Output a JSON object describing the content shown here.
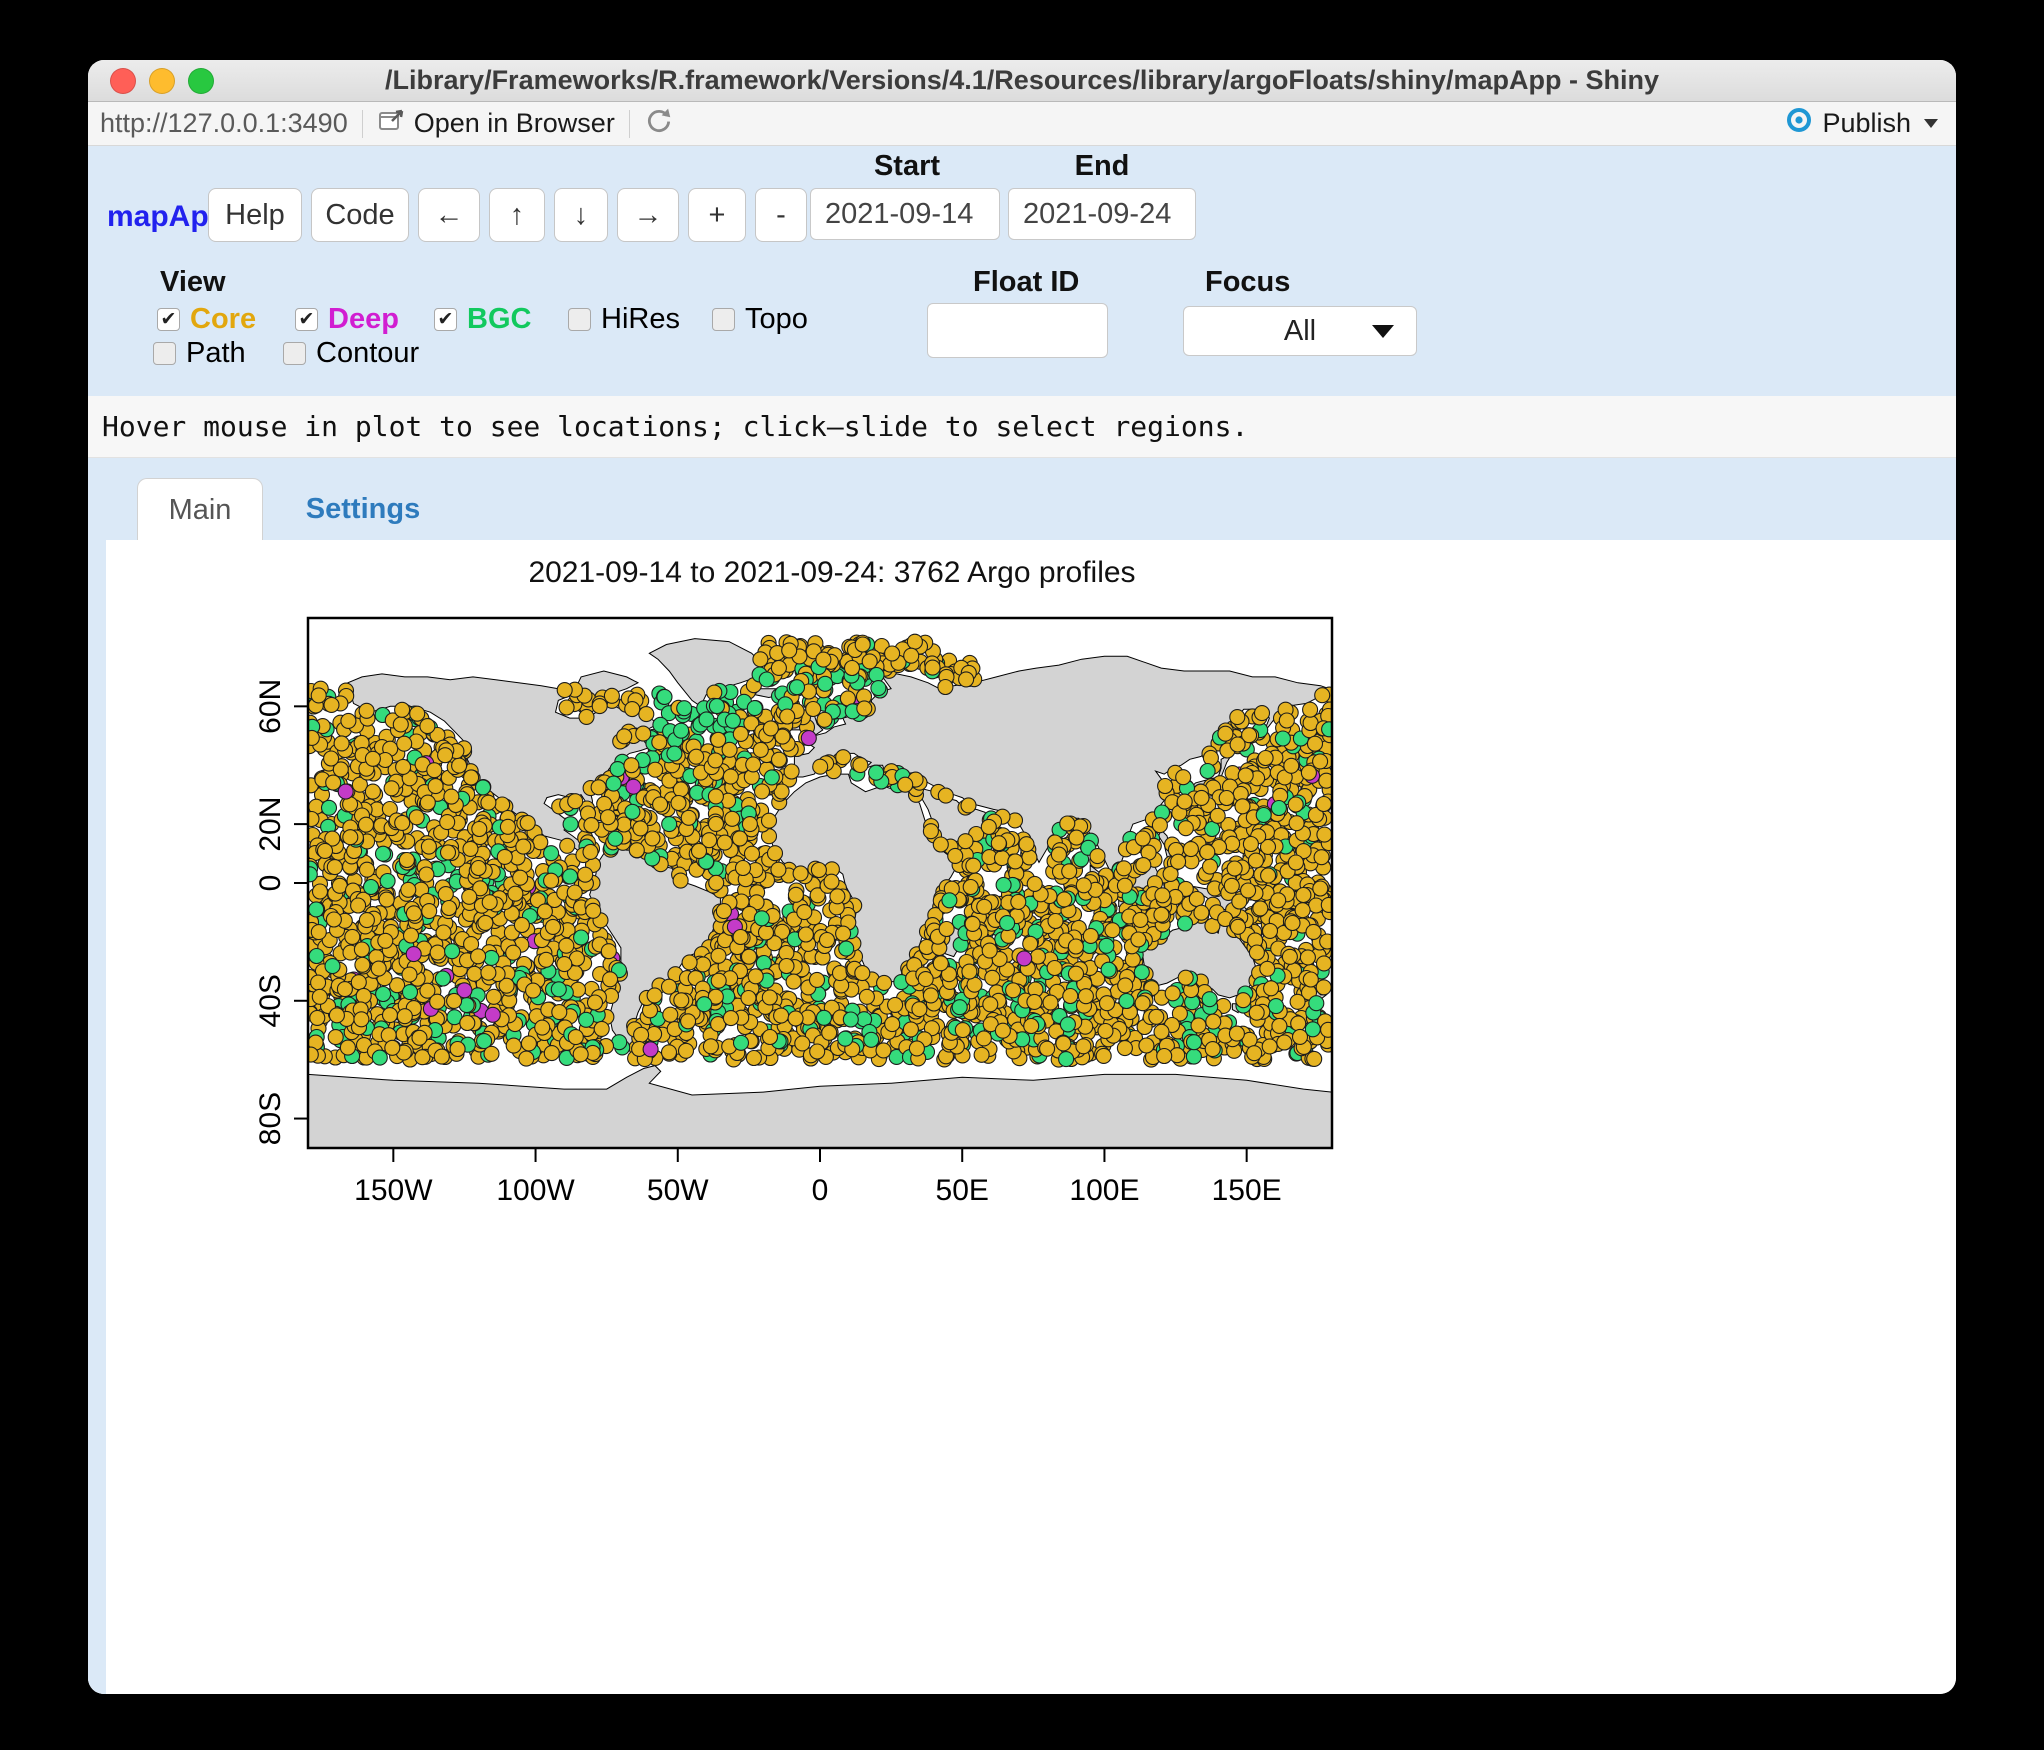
{
  "window": {
    "title": "/Library/Frameworks/R.framework/Versions/4.1/Resources/library/argoFloats/shiny/mapApp - Shiny"
  },
  "browser_bar": {
    "url": "http://127.0.0.1:3490",
    "open_in_browser": "Open in Browser",
    "publish": "Publish"
  },
  "controls": {
    "app_name": "mapApp",
    "app_name_color": "#2222ee",
    "buttons": {
      "help": "Help",
      "code": "Code",
      "left": "←",
      "up": "↑",
      "down": "↓",
      "right": "→",
      "zoom_in": "+",
      "zoom_out": "-"
    },
    "dates": {
      "start_label": "Start",
      "end_label": "End",
      "start_value": "2021-09-14",
      "end_value": "2021-09-24"
    },
    "view": {
      "label": "View",
      "row1": [
        {
          "label": "Core",
          "checked": true,
          "color": "#e2a70e"
        },
        {
          "label": "Deep",
          "checked": true,
          "color": "#d11ed1"
        },
        {
          "label": "BGC",
          "checked": true,
          "color": "#12c95e"
        },
        {
          "label": "HiRes",
          "checked": false,
          "color": "#000000"
        },
        {
          "label": "Topo",
          "checked": false,
          "color": "#000000"
        }
      ],
      "row2": [
        {
          "label": "Path",
          "checked": false,
          "color": "#000000"
        },
        {
          "label": "Contour",
          "checked": false,
          "color": "#000000"
        }
      ]
    },
    "float_id": {
      "label": "Float ID",
      "value": "",
      "placeholder": ""
    },
    "focus": {
      "label": "Focus",
      "value": "All"
    }
  },
  "status_bar": {
    "message": "Hover mouse in plot to see locations; click–slide to select regions."
  },
  "tabs": [
    {
      "label": "Main",
      "active": true
    },
    {
      "label": "Settings",
      "active": false,
      "link_color": "#2e7bbd"
    }
  ],
  "chart_data": {
    "type": "scatter",
    "title": "2021-09-14 to 2021-09-24: 3762 Argo profiles",
    "total_profiles": 3762,
    "date_range": [
      "2021-09-14",
      "2021-09-24"
    ],
    "projection": "equirectangular",
    "lon_range": [
      -180,
      180
    ],
    "lat_range": [
      -90,
      90
    ],
    "x_ticks": [
      {
        "label": "150W",
        "lon": -150
      },
      {
        "label": "100W",
        "lon": -100
      },
      {
        "label": "50W",
        "lon": -50
      },
      {
        "label": "0",
        "lon": 0
      },
      {
        "label": "50E",
        "lon": 50
      },
      {
        "label": "100E",
        "lon": 100
      },
      {
        "label": "150E",
        "lon": 150
      }
    ],
    "y_ticks": [
      {
        "label": "60N",
        "lat": 60
      },
      {
        "label": "20N",
        "lat": 20
      },
      {
        "label": "0",
        "lat": 0
      },
      {
        "label": "40S",
        "lat": -40
      },
      {
        "label": "80S",
        "lat": -80
      }
    ],
    "series": [
      {
        "name": "Core",
        "color": "#e6b422",
        "share": 0.8
      },
      {
        "name": "BGC",
        "color": "#35dc7c",
        "share": 0.18
      },
      {
        "name": "Deep",
        "color": "#c43bc8",
        "share": 0.02
      }
    ],
    "point_radius": 7.5,
    "land_color": "#d3d3d3",
    "ocean_color": "#ffffff",
    "seed": 20210914
  }
}
